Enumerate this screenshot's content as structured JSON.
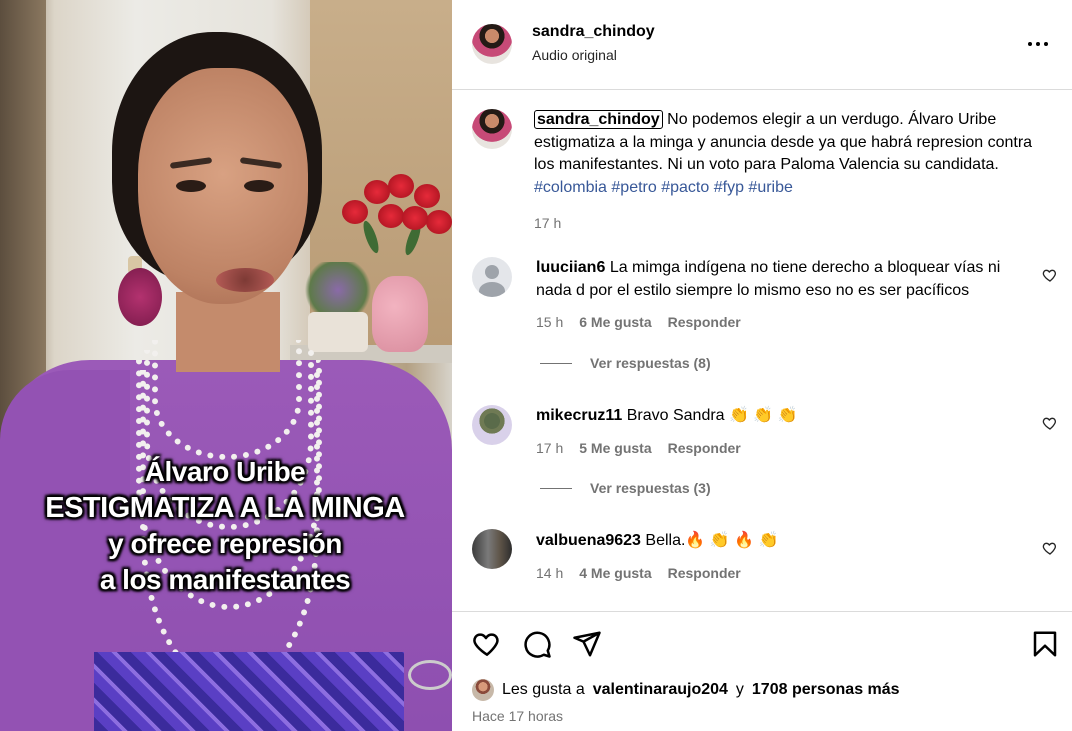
{
  "video": {
    "overlay_lines": [
      "Álvaro Uribe",
      "ESTIGMATIZA A LA MINGA",
      "y ofrece represión",
      "a los manifestantes"
    ]
  },
  "header": {
    "username": "sandra_chindoy",
    "subtitle": "Audio original",
    "more_icon": "more-horizontal-icon"
  },
  "caption": {
    "username": "sandra_chindoy",
    "text": "No podemos elegir a un verdugo. Álvaro Uribe estigmatiza a la minga y anuncia desde ya que habrá represion contra los manifestantes. Ni un voto para Paloma Valencia su candidata.",
    "hashtags": [
      "#colombia",
      "#petro",
      "#pacto",
      "#fyp",
      "#uribe"
    ],
    "time": "17 h"
  },
  "comments": [
    {
      "username": "luuciian6",
      "text": "La mimga indígena no tiene derecho a bloquear vías ni nada d por el estilo siempre lo mismo eso no es ser pacíficos",
      "time": "15 h",
      "likes": "6 Me gusta",
      "reply": "Responder",
      "view_replies": "Ver respuestas (8)"
    },
    {
      "username": "mikecruz11",
      "text": "Bravo Sandra 👏 👏 👏",
      "time": "17 h",
      "likes": "5 Me gusta",
      "reply": "Responder",
      "view_replies": "Ver respuestas (3)"
    },
    {
      "username": "valbuena9623",
      "text": "Bella.🔥 👏 🔥 👏",
      "time": "14 h",
      "likes": "4 Me gusta",
      "reply": "Responder"
    }
  ],
  "actions": {
    "like_icon": "heart-icon",
    "comment_icon": "comment-icon",
    "share_icon": "send-icon",
    "save_icon": "bookmark-icon"
  },
  "likes_summary": {
    "prefix": "Les gusta a",
    "user": "valentinaraujo204",
    "joiner": "y",
    "others": "1708 personas más"
  },
  "posted": "Hace 17 horas"
}
